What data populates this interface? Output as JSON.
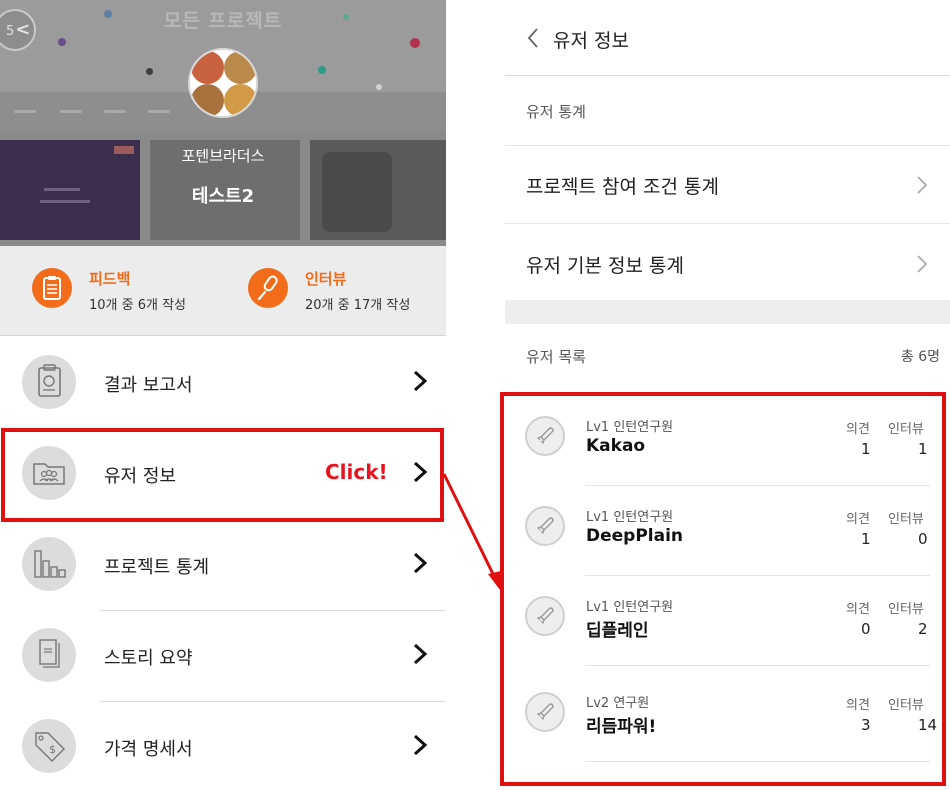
{
  "left": {
    "hero_title": "모든 프로젝트",
    "back_badge": "5",
    "team_name": "포텐브라더스",
    "project_name": "테스트2",
    "stats": [
      {
        "label": "피드백",
        "sub": "10개 중 6개 작성",
        "icon": "clipboard-icon"
      },
      {
        "label": "인터뷰",
        "sub": "20개 중 17개 작성",
        "icon": "microphone-icon"
      }
    ],
    "menu": [
      {
        "label": "결과 보고서",
        "icon": "report-icon"
      },
      {
        "label": "유저 정보",
        "icon": "users-folder-icon"
      },
      {
        "label": "프로젝트 통계",
        "icon": "bar-chart-icon"
      },
      {
        "label": "스토리 요약",
        "icon": "document-icon"
      },
      {
        "label": "가격 명세서",
        "icon": "price-tag-icon"
      }
    ],
    "click_label": "Click!"
  },
  "right": {
    "title": "유저 정보",
    "stats_section": "유저 통계",
    "stats_rows": [
      "프로젝트 참여 조건 통계",
      "유저 기본 정보 통계"
    ],
    "list_section": "유저 목록",
    "total": "총 6명",
    "col_opinion": "의견",
    "col_interview": "인터뷰",
    "users": [
      {
        "level": "Lv1 인턴연구원",
        "name": "Kakao",
        "opinion": "1",
        "interview": "1"
      },
      {
        "level": "Lv1 인턴연구원",
        "name": "DeepPlain",
        "opinion": "1",
        "interview": "0"
      },
      {
        "level": "Lv1 인턴연구원",
        "name": "딥플레인",
        "opinion": "0",
        "interview": "2"
      },
      {
        "level": "Lv2 연구원",
        "name": "리듬파워!",
        "opinion": "3",
        "interview": "14"
      }
    ]
  },
  "colors": {
    "accent": "#f26c1a",
    "highlight": "#e01010"
  }
}
